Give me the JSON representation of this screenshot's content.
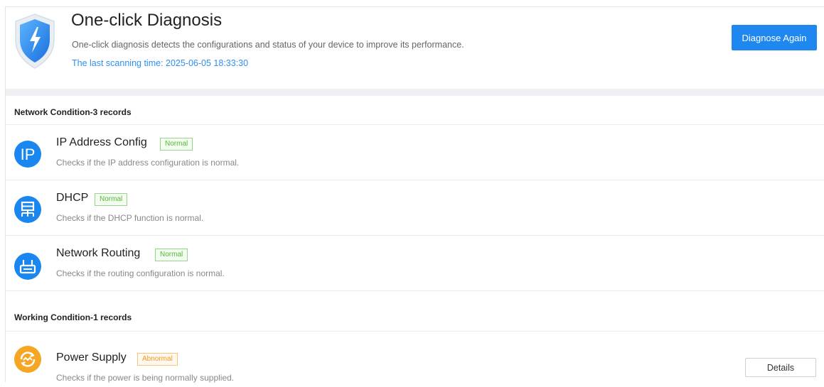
{
  "header": {
    "title": "One-click Diagnosis",
    "description": "One-click diagnosis detects the configurations and status of your device to improve its performance.",
    "last_scan": "The last scanning time: 2025-06-05 18:33:30",
    "diagnose_button": "Diagnose Again",
    "shield_icon": "shield-lightning-icon"
  },
  "sections": [
    {
      "heading": "Network Condition-3 records",
      "items": [
        {
          "name": "IP Address Config",
          "status": "Normal",
          "description": "Checks if the IP address configuration is normal.",
          "icon": "ip-icon"
        },
        {
          "name": "DHCP",
          "status": "Normal",
          "description": "Checks if the DHCP function is normal.",
          "icon": "dhcp-network-icon"
        },
        {
          "name": "Network Routing",
          "status": "Normal",
          "description": "Checks if the routing configuration is normal.",
          "icon": "router-icon"
        }
      ]
    },
    {
      "heading": "Working Condition-1 records",
      "items": [
        {
          "name": "Power Supply",
          "status": "Abnormal",
          "description": "Checks if the power is being normally supplied.",
          "icon": "power-supply-icon",
          "action": "Details"
        }
      ]
    }
  ],
  "colors": {
    "accent": "#1f87f0",
    "normal": "#52b934",
    "abnormal": "#f39a1e",
    "icon_blue": "#1a86ef",
    "icon_orange": "#f5a623"
  }
}
